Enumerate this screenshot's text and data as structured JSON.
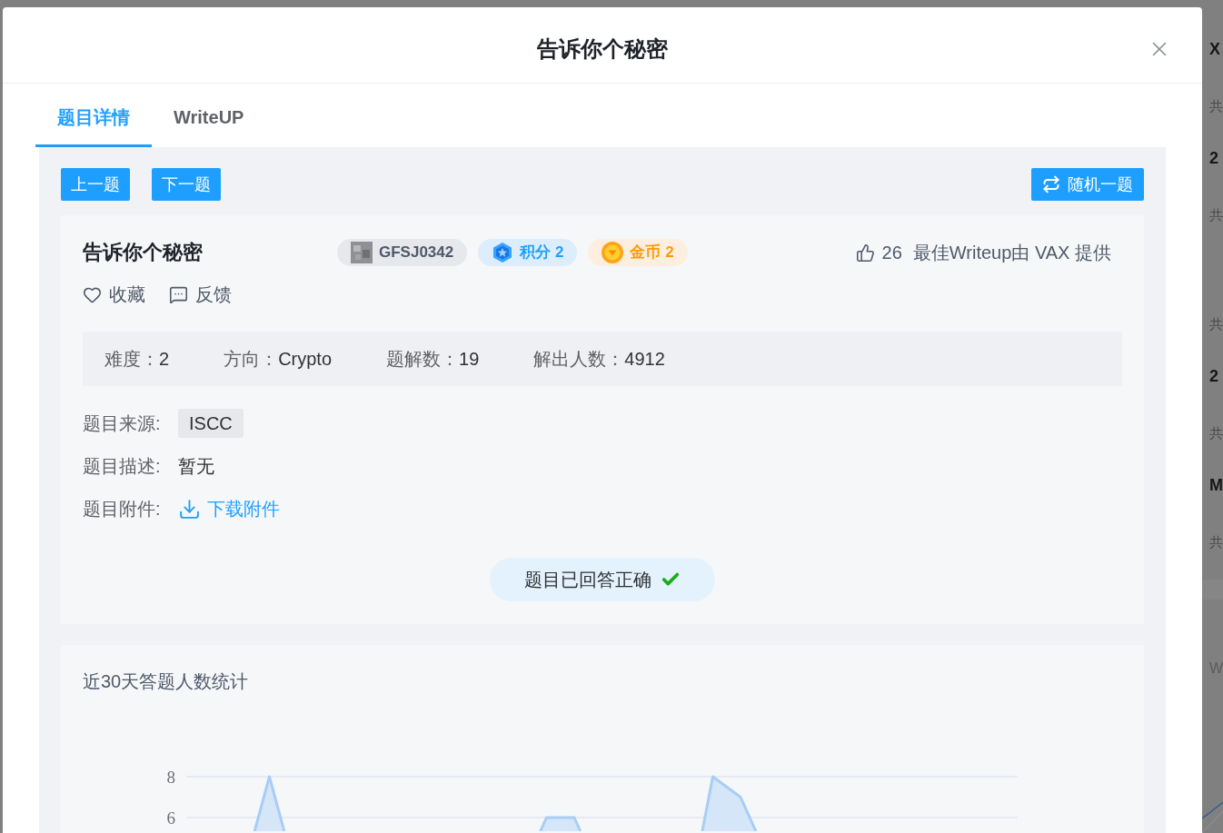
{
  "background_page": {
    "cards": [
      {
        "title": "X",
        "meta": "共"
      },
      {
        "title": "2",
        "meta": "共"
      },
      {
        "meta": "共"
      },
      {
        "title": "2",
        "meta": "共"
      },
      {
        "title": "M",
        "meta": "共"
      }
    ],
    "section_title": "W"
  },
  "dialog": {
    "title": "告诉你个秘密"
  },
  "tabs": [
    {
      "label": "题目详情",
      "selected": true
    },
    {
      "label": "WriteUP",
      "selected": false
    }
  ],
  "nav_buttons": [
    {
      "label": "上一题"
    },
    {
      "label": "下一题"
    }
  ],
  "random_button": {
    "label": "随机一题"
  },
  "challenge": {
    "title": "告诉你个秘密",
    "badges": [
      {
        "kind": "id",
        "text": "GFSJ0342"
      },
      {
        "kind": "score",
        "text": "积分 2"
      },
      {
        "kind": "coin",
        "text": "金币 2"
      }
    ],
    "likes": "26",
    "best_writeup": "最佳Writeup由 VAX 提供",
    "actions": [
      {
        "kind": "favorite",
        "label": "收藏"
      },
      {
        "kind": "feedback",
        "label": "反馈"
      }
    ],
    "stats": [
      {
        "label": "难度：",
        "value": "2"
      },
      {
        "label": "方向：",
        "value": "Crypto"
      },
      {
        "label": "题解数：",
        "value": "19"
      },
      {
        "label": "解出人数：",
        "value": "4912"
      }
    ],
    "source": {
      "label": "题目来源:",
      "value": "ISCC"
    },
    "description": {
      "label": "题目描述:",
      "value": "暂无"
    },
    "attachment": {
      "label": "题目附件:",
      "link": "下载附件"
    },
    "status": {
      "text": "题目已回答正确",
      "answered": true
    }
  },
  "chart": {
    "title": "近30天答题人数统计",
    "y_axis_labels": [
      "8",
      "6"
    ]
  }
}
